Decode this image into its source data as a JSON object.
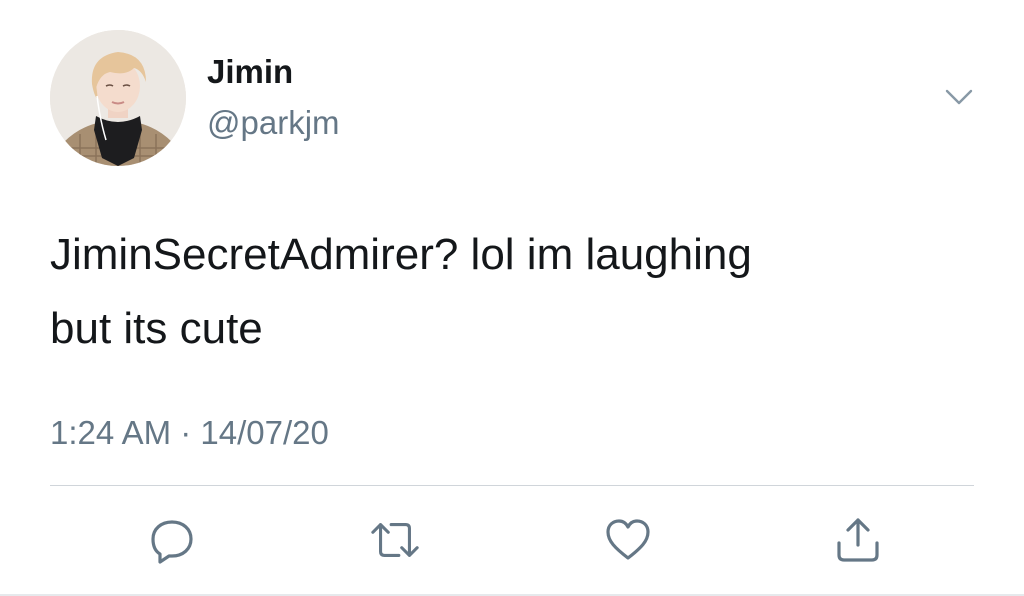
{
  "tweet": {
    "author": {
      "display_name": "Jimin",
      "handle": "@parkjm",
      "avatar": "profile-photo"
    },
    "text_line_1": "JiminSecretAdmirer? lol im laughing",
    "text_line_2": "but its cute",
    "timestamp": "1:24 AM · 14/07/20",
    "menu_icon": "chevron-down-icon",
    "actions": [
      {
        "name": "reply",
        "icon": "reply-icon"
      },
      {
        "name": "retweet",
        "icon": "retweet-icon"
      },
      {
        "name": "like",
        "icon": "heart-icon"
      },
      {
        "name": "share",
        "icon": "share-icon"
      }
    ]
  },
  "colors": {
    "primary_text": "#14171a",
    "secondary_text": "#657786",
    "divider": "#d0d5da"
  }
}
